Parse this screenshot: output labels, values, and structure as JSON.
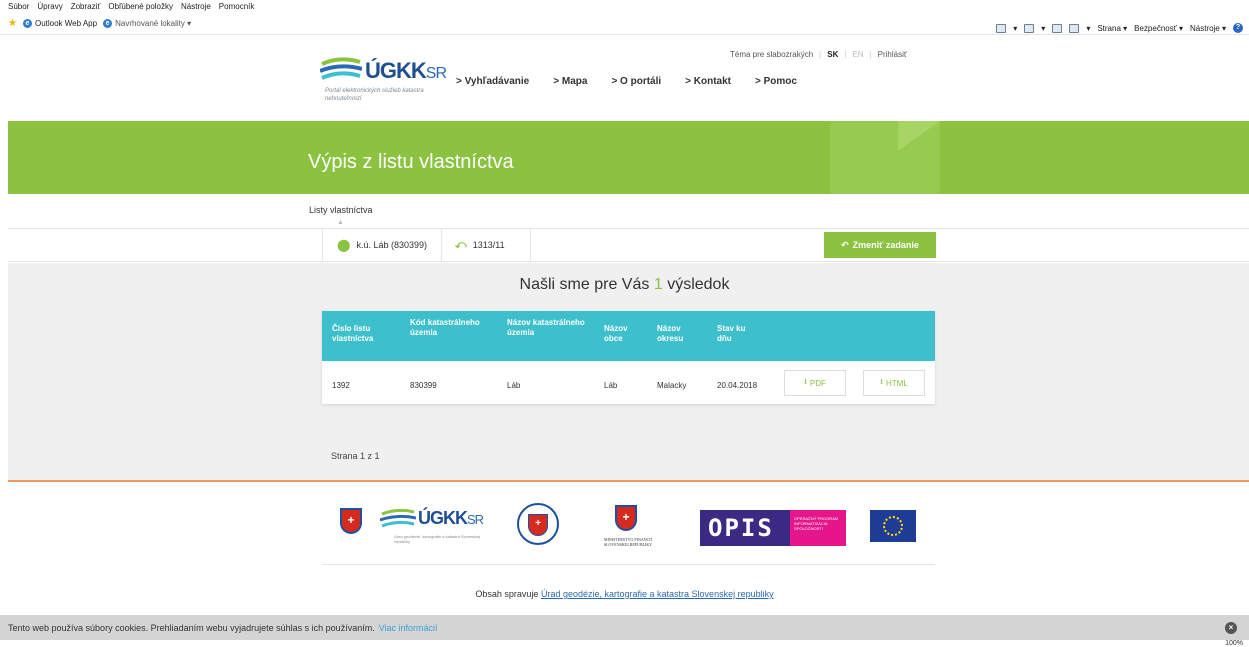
{
  "browser": {
    "menu": [
      "Súbor",
      "Úpravy",
      "Zobraziť",
      "Obľúbené položky",
      "Nástroje",
      "Pomocník"
    ],
    "favorites": [
      "Outlook Web App",
      "Navrhované lokality ▾"
    ],
    "commands": [
      "Strana ▾",
      "Bezpečnosť ▾",
      "Nástroje ▾"
    ],
    "zoom": "100%"
  },
  "header": {
    "links": {
      "contrast": "Téma pre slabozrakých",
      "lang_sk": "SK",
      "lang_en": "EN",
      "login": "Prihlásiť"
    },
    "logo": {
      "name": "ÚGKK",
      "suffix": "SR",
      "subtitle": "Portál elektronických služieb katastra nehnuteľností"
    },
    "nav": [
      "> Vyhľadávanie",
      "> Mapa",
      "> O portáli",
      "> Kontakt",
      "> Pomoc"
    ]
  },
  "banner": {
    "title": "Výpis z listu vlastníctva"
  },
  "breadcrumb": "Listy vlastníctva",
  "filters": {
    "cadastral_area": "k.ú. Láb (830399)",
    "parcel": "1313/11",
    "change_button": "Zmeniť zadanie"
  },
  "results": {
    "prefix": "Našli sme pre Vás",
    "count": "1",
    "suffix": "výsledok",
    "columns": [
      "Číslo listu vlastníctva",
      "Kód katastrálneho územia",
      "Názov katastrálneho územia",
      "Názov obce",
      "Názov okresu",
      "Stav ku dňu"
    ],
    "rows": [
      {
        "lv": "1392",
        "ku_code": "830399",
        "ku_name": "Láb",
        "municipality": "Láb",
        "district": "Malacky",
        "date": "20.04.2018",
        "pdf": "PDF",
        "html": "HTML"
      }
    ]
  },
  "pager": "Strana 1 z 1",
  "footer": {
    "logo_name": "ÚGKK",
    "logo_suffix": "SR",
    "logo_sub": "Úrad geodézie, kartografie a katastra Slovenskej republiky",
    "minfin": "MINISTERSTVO FINANCIÍ SLOVENSKEJ REPUBLIKY",
    "opis": "OPIS",
    "opis_sub": "OPERAČNÝ PROGRAM INFORMATIZÁCIA SPOLOČNOSTI",
    "managed_by": "Obsah spravuje",
    "managed_link": "Úrad geodézie, kartografie a katastra Slovenskej republiky"
  },
  "cookie": {
    "text": "Tento web používa súbory cookies. Prehliadaním webu vyjadrujete súhlas s ich používaním.",
    "more": "Viac informácií"
  },
  "colors": {
    "accent_green": "#8bc23f",
    "table_header": "#3dbfcc",
    "footer_line": "#f39a5a",
    "brand_blue": "#1f4f91"
  }
}
